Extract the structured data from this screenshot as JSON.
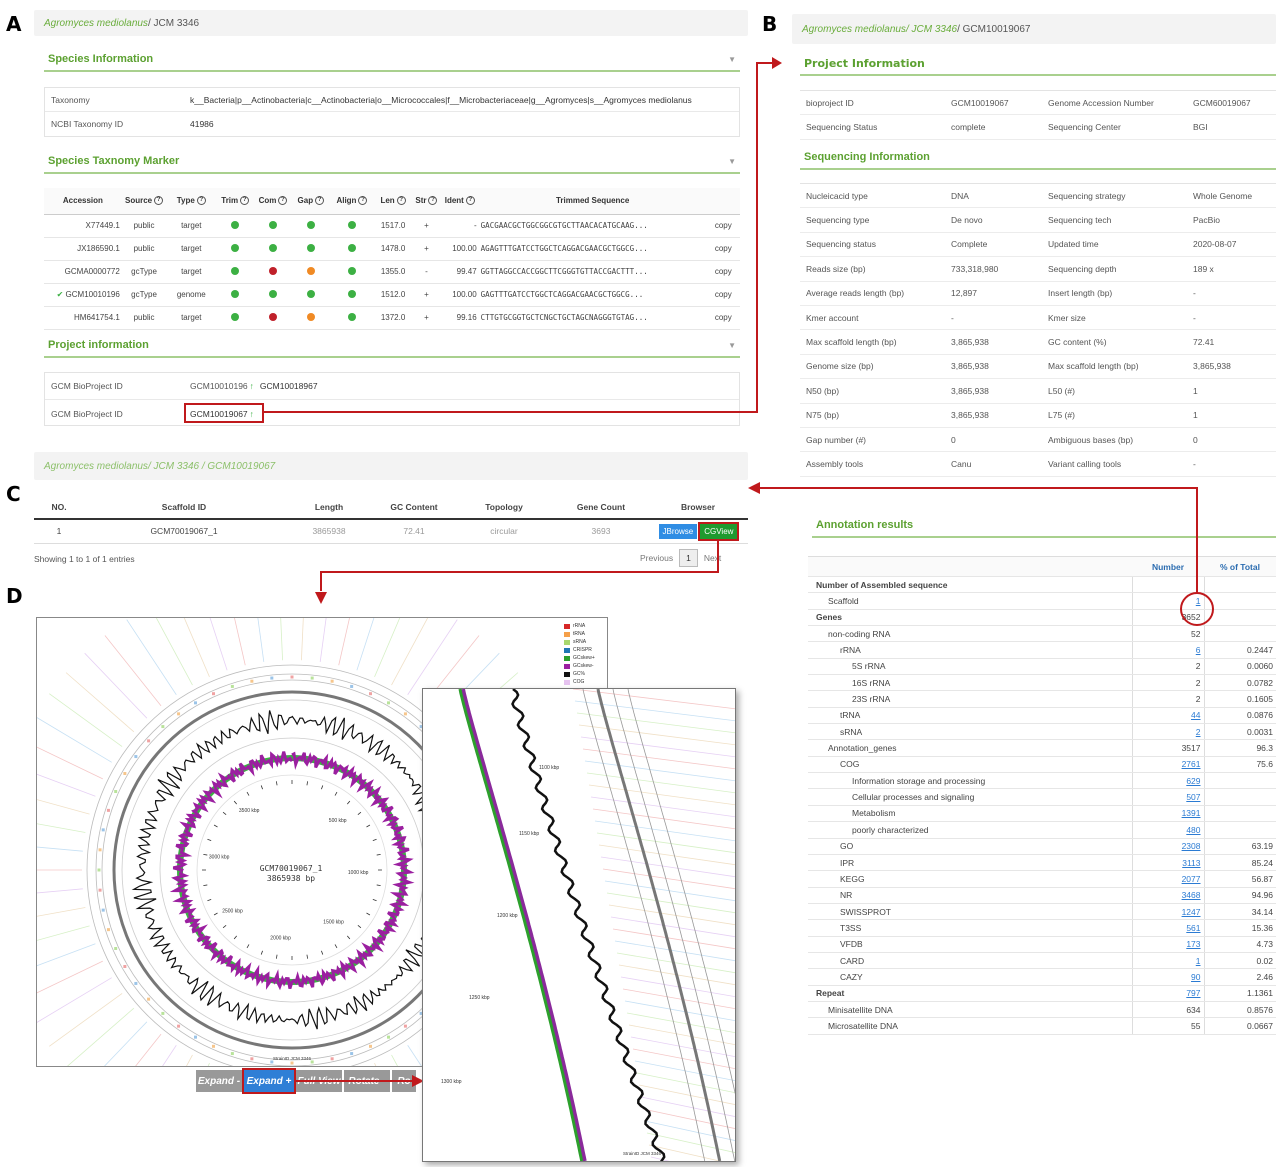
{
  "panels": {
    "a": "A",
    "b": "B",
    "c": "C",
    "d": "D"
  },
  "panel_a": {
    "breadcrumb_species": "Agromyces mediolanus",
    "breadcrumb_strain": " / JCM 3346",
    "species_section": "Species Information",
    "taxonomy_label": "Taxonomy",
    "taxonomy_value": "k__Bacteria|p__Actinobacteria|c__Actinobacteria|o__Micrococcales|f__Microbacteriaceae|g__Agromyces|s__Agromyces mediolanus",
    "ncbi_label": "NCBI Taxonomy ID",
    "ncbi_value": "41986",
    "marker_section": "Species Taxnomy Marker",
    "marker_headers": [
      "Accession",
      "Source",
      "Type",
      "Trim",
      "Com",
      "Gap",
      "Align",
      "Len",
      "Str",
      "Ident",
      "Trimmed Sequence",
      ""
    ],
    "marker_rows": [
      {
        "acc": "X77449.1",
        "src": "public",
        "type": "target",
        "trim": "g",
        "com": "g",
        "gap": "g",
        "align": "g",
        "len": "1517.0",
        "str": "+",
        "ident": "-",
        "seq": "GACGAACGCTGGCGGCGTGCTTAACACATGCAAG...",
        "act": "copy"
      },
      {
        "acc": "JX186590.1",
        "src": "public",
        "type": "target",
        "trim": "g",
        "com": "g",
        "gap": "g",
        "align": "g",
        "len": "1478.0",
        "str": "+",
        "ident": "100.00",
        "seq": "AGAGTTTGATCCTGGCTCAGGACGAACGCTGGCG...",
        "act": "copy"
      },
      {
        "acc": "GCMA0000772",
        "src": "gcType",
        "type": "target",
        "trim": "g",
        "com": "r",
        "gap": "o",
        "align": "g",
        "len": "1355.0",
        "str": "-",
        "ident": "99.47",
        "seq": "GGTTAGGCCACCGGCTTCGGGTGTTACCGACTTT...",
        "act": "copy"
      },
      {
        "acc": "GCM10010196",
        "src": "gcType",
        "type": "genome",
        "trim": "g",
        "com": "g",
        "gap": "g",
        "align": "g",
        "len": "1512.0",
        "str": "+",
        "ident": "100.00",
        "seq": "GAGTTTGATCCTGGCTCAGGACGAACGCTGGCG...",
        "act": "copy"
      },
      {
        "acc": "HM641754.1",
        "src": "public",
        "type": "target",
        "trim": "g",
        "com": "r",
        "gap": "o",
        "align": "g",
        "len": "1372.0",
        "str": "+",
        "ident": "99.16",
        "seq": "CTTGTGCGGTGCTCNGCTGCTAGCNAGGGTGTAG...",
        "act": "copy"
      }
    ],
    "project_section": "Project information",
    "bp1_label": "GCM BioProject ID",
    "bp1_value": "GCM10010196",
    "bp1_other": "GCM10018967",
    "bp2_label": "GCM BioProject ID",
    "bp2_value": "GCM10019067"
  },
  "panel_b": {
    "bc_species": "Agromyces mediolanus",
    "bc_strain": " / JCM 3346",
    "bc_project": " / GCM10019067",
    "project_section": "Project Information",
    "project_rows": [
      [
        "bioproject ID",
        "GCM10019067",
        "Genome Accession Number",
        "GCM60019067"
      ],
      [
        "Sequencing Status",
        "complete",
        "Sequencing Center",
        "BGI"
      ]
    ],
    "seq_section": "Sequencing Information",
    "seq_rows": [
      [
        "Nucleicacid type",
        "DNA",
        "Sequencing strategy",
        "Whole Genome"
      ],
      [
        "Sequencing type",
        "De novo",
        "Sequencing tech",
        "PacBio"
      ],
      [
        "Sequencing status",
        "Complete",
        "Updated time",
        "2020-08-07"
      ],
      [
        "Reads size (bp)",
        "733,318,980",
        "Sequencing depth",
        "189 x"
      ],
      [
        "Average reads length (bp)",
        "12,897",
        "Insert length (bp)",
        "-"
      ],
      [
        "Kmer account",
        "-",
        "Kmer size",
        "-"
      ],
      [
        "Max scaffold length (bp)",
        "3,865,938",
        "GC content (%)",
        "72.41"
      ],
      [
        "Genome size (bp)",
        "3,865,938",
        "Max scaffold length (bp)",
        "3,865,938"
      ],
      [
        "N50 (bp)",
        "3,865,938",
        "L50 (#)",
        "1"
      ],
      [
        "N75 (bp)",
        "3,865,938",
        "L75 (#)",
        "1"
      ],
      [
        "Gap number (#)",
        "0",
        "Ambiguous bases (bp)",
        "0"
      ],
      [
        "Assembly tools",
        "Canu",
        "Variant calling tools",
        "-"
      ]
    ],
    "anno_title": "Annotation results",
    "anno_headers": [
      "",
      "Number",
      "% of Total"
    ],
    "anno_rows": [
      {
        "label": "Number of Assembled sequence",
        "num": "",
        "pct": "",
        "lvl": 0,
        "bold": true,
        "link": false
      },
      {
        "label": "Scaffold",
        "num": "1",
        "pct": "",
        "lvl": 1,
        "bold": false,
        "link": true
      },
      {
        "label": "Genes",
        "num": "3652",
        "pct": "",
        "lvl": 0,
        "bold": true,
        "link": false
      },
      {
        "label": "non-coding RNA",
        "num": "52",
        "pct": "",
        "lvl": 1,
        "bold": false,
        "link": false
      },
      {
        "label": "rRNA",
        "num": "6",
        "pct": "0.2447",
        "lvl": 2,
        "bold": false,
        "link": true
      },
      {
        "label": "5S rRNA",
        "num": "2",
        "pct": "0.0060",
        "lvl": 3,
        "bold": false,
        "link": false
      },
      {
        "label": "16S rRNA",
        "num": "2",
        "pct": "0.0782",
        "lvl": 3,
        "bold": false,
        "link": false
      },
      {
        "label": "23S rRNA",
        "num": "2",
        "pct": "0.1605",
        "lvl": 3,
        "bold": false,
        "link": false
      },
      {
        "label": "tRNA",
        "num": "44",
        "pct": "0.0876",
        "lvl": 2,
        "bold": false,
        "link": true
      },
      {
        "label": "sRNA",
        "num": "2",
        "pct": "0.0031",
        "lvl": 2,
        "bold": false,
        "link": true
      },
      {
        "label": "Annotation_genes",
        "num": "3517",
        "pct": "96.3",
        "lvl": 1,
        "bold": false,
        "link": false
      },
      {
        "label": "COG",
        "num": "2761",
        "pct": "75.6",
        "lvl": 2,
        "bold": false,
        "link": true
      },
      {
        "label": "Information storage and processing",
        "num": "629",
        "pct": "",
        "lvl": 3,
        "bold": false,
        "link": true
      },
      {
        "label": "Cellular processes and signaling",
        "num": "507",
        "pct": "",
        "lvl": 3,
        "bold": false,
        "link": true
      },
      {
        "label": "Metabolism",
        "num": "1391",
        "pct": "",
        "lvl": 3,
        "bold": false,
        "link": true
      },
      {
        "label": "poorly characterized",
        "num": "480",
        "pct": "",
        "lvl": 3,
        "bold": false,
        "link": true
      },
      {
        "label": "GO",
        "num": "2308",
        "pct": "63.19",
        "lvl": 2,
        "bold": false,
        "link": true
      },
      {
        "label": "IPR",
        "num": "3113",
        "pct": "85.24",
        "lvl": 2,
        "bold": false,
        "link": true
      },
      {
        "label": "KEGG",
        "num": "2077",
        "pct": "56.87",
        "lvl": 2,
        "bold": false,
        "link": true
      },
      {
        "label": "NR",
        "num": "3468",
        "pct": "94.96",
        "lvl": 2,
        "bold": false,
        "link": true
      },
      {
        "label": "SWISSPROT",
        "num": "1247",
        "pct": "34.14",
        "lvl": 2,
        "bold": false,
        "link": true
      },
      {
        "label": "T3SS",
        "num": "561",
        "pct": "15.36",
        "lvl": 2,
        "bold": false,
        "link": true
      },
      {
        "label": "VFDB",
        "num": "173",
        "pct": "4.73",
        "lvl": 2,
        "bold": false,
        "link": true
      },
      {
        "label": "CARD",
        "num": "1",
        "pct": "0.02",
        "lvl": 2,
        "bold": false,
        "link": true
      },
      {
        "label": "CAZY",
        "num": "90",
        "pct": "2.46",
        "lvl": 2,
        "bold": false,
        "link": true
      },
      {
        "label": "Repeat",
        "num": "797",
        "pct": "1.1361",
        "lvl": 0,
        "bold": true,
        "link": true
      },
      {
        "label": "Minisatellite DNA",
        "num": "634",
        "pct": "0.8576",
        "lvl": 1,
        "bold": false,
        "link": false
      },
      {
        "label": "Microsatellite DNA",
        "num": "55",
        "pct": "0.0667",
        "lvl": 1,
        "bold": false,
        "link": false
      }
    ]
  },
  "panel_c": {
    "bc_species": "Agromyces mediolanus",
    "bc_rest": " / JCM 3346  / GCM10019067",
    "headers": [
      "NO.",
      "Scaffold ID",
      "Length",
      "GC Content",
      "Topology",
      "Gene Count",
      "Browser"
    ],
    "row": {
      "no": "1",
      "id": "GCM70019067_1",
      "len": "3865938",
      "gc": "72.41",
      "topo": "circular",
      "genes": "3693"
    },
    "jbrowse": "JBrowse",
    "cgview": "CGView",
    "showing": "Showing 1 to 1 of 1 entries",
    "prev": "Previous",
    "page": "1",
    "next": "Next"
  },
  "panel_d": {
    "center_id": "GCM70019067_1",
    "center_bp": "3865938 bp",
    "ticks": [
      "500 kbp",
      "1000 kbp",
      "1500 kbp",
      "2000 kbp",
      "2500 kbp",
      "3000 kbp",
      "3500 kbp"
    ],
    "legend": [
      {
        "label": "rRNA",
        "color": "#d62728"
      },
      {
        "label": "tRNA",
        "color": "#f5a04a"
      },
      {
        "label": "sRNA",
        "color": "#a8d86e"
      },
      {
        "label": "CRISPR",
        "color": "#1f77b4"
      },
      {
        "label": "GCskew+",
        "color": "#2ca02c"
      },
      {
        "label": "GCskew-",
        "color": "#9b1fa0"
      },
      {
        "label": "GC%",
        "color": "#111111"
      },
      {
        "label": "COG",
        "color": "#e6c3f0"
      }
    ],
    "strain_label": "StrainID JCM 3346",
    "zoom_ticks": [
      "1100 kbp",
      "1150 kbp",
      "1200 kbp",
      "1250 kbp",
      "1300 kbp"
    ],
    "zoom_strain": "StrainID JCM 3346",
    "controls": [
      "Expand -",
      "Expand +",
      "Full View",
      "Rotate -",
      "Ro"
    ]
  }
}
